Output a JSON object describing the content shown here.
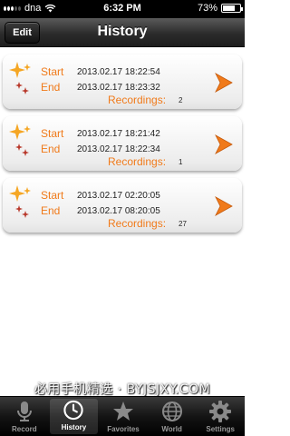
{
  "status_bar": {
    "carrier": "dna",
    "time": "6:32 PM",
    "battery": "73%",
    "battery_level": 0.73
  },
  "nav": {
    "title": "History",
    "edit_label": "Edit"
  },
  "records": [
    {
      "start_label": "Start",
      "start": "2013.02.17 18:22:54",
      "end_label": "End",
      "end": "2013.02.17 18:23:32",
      "recordings_label": "Recordings:",
      "count": "2"
    },
    {
      "start_label": "Start",
      "start": "2013.02.17 18:21:42",
      "end_label": "End",
      "end": "2013.02.17 18:22:34",
      "recordings_label": "Recordings:",
      "count": "1"
    },
    {
      "start_label": "Start",
      "start": "2013.02.17 02:20:05",
      "end_label": "End",
      "end": "2013.02.17 08:20:05",
      "recordings_label": "Recordings:",
      "count": "27"
    }
  ],
  "tabs": [
    {
      "label": "Record",
      "icon": "microphone-icon",
      "active": false
    },
    {
      "label": "History",
      "icon": "clock-icon",
      "active": true
    },
    {
      "label": "Favorites",
      "icon": "star-icon",
      "active": false
    },
    {
      "label": "World",
      "icon": "globe-icon",
      "active": false
    },
    {
      "label": "Settings",
      "icon": "gear-icon",
      "active": false
    }
  ],
  "watermark": "必用手机精选 · BYJSJXY.COM",
  "colors": {
    "accent_orange": "#f07a1a",
    "nav_bar": "#2c2c2c",
    "status_bar": "#000000"
  }
}
